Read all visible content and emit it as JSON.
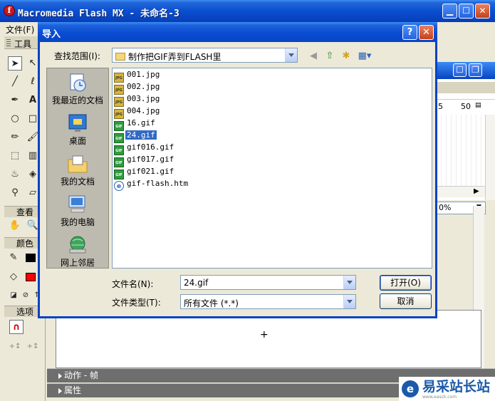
{
  "app": {
    "title": "Macromedia Flash MX - 未命名-3",
    "menu_partial": "文件(F)",
    "caption_buttons": [
      "minimize",
      "maximize",
      "close"
    ]
  },
  "tools_panel": {
    "header": "工具",
    "sections": {
      "view": "查看",
      "colors": "颜色",
      "options": "选项"
    }
  },
  "bottom_panels": [
    {
      "label": "动作 - 帧"
    },
    {
      "label": "属性"
    }
  ],
  "stage": {
    "center_marker": "+"
  },
  "timeline": {
    "frame_labels": [
      "5",
      "50"
    ],
    "zoom": "0%"
  },
  "watermark": {
    "logo_text": "e",
    "text": "易采站长站",
    "sub": "www.easck.com"
  },
  "dialog": {
    "title": "导入",
    "help_label": "?",
    "close_label": "✕",
    "look_in": {
      "label": "查找范围(I):",
      "value": "制作把GIF弄到FLASH里"
    },
    "places": [
      {
        "label": "我最近的文档",
        "icon": "recent-documents-icon"
      },
      {
        "label": "桌面",
        "icon": "desktop-icon"
      },
      {
        "label": "我的文档",
        "icon": "my-documents-icon"
      },
      {
        "label": "我的电脑",
        "icon": "my-computer-icon"
      },
      {
        "label": "网上邻居",
        "icon": "network-places-icon"
      }
    ],
    "files": [
      {
        "name": "001.jpg",
        "type": "jpg",
        "selected": false
      },
      {
        "name": "002.jpg",
        "type": "jpg",
        "selected": false
      },
      {
        "name": "003.jpg",
        "type": "jpg",
        "selected": false
      },
      {
        "name": "004.jpg",
        "type": "jpg",
        "selected": false
      },
      {
        "name": "16.gif",
        "type": "gif",
        "selected": false
      },
      {
        "name": "24.gif",
        "type": "gif",
        "selected": true
      },
      {
        "name": "gif016.gif",
        "type": "gif",
        "selected": false
      },
      {
        "name": "gif017.gif",
        "type": "gif",
        "selected": false
      },
      {
        "name": "gif021.gif",
        "type": "gif",
        "selected": false
      },
      {
        "name": "gif-flash.htm",
        "type": "htm",
        "selected": false
      }
    ],
    "filename": {
      "label": "文件名(N):",
      "value": "24.gif"
    },
    "filetype": {
      "label": "文件类型(T):",
      "value": "所有文件 (*.*)"
    },
    "open_label": "打开(O)",
    "cancel_label": "取消"
  }
}
